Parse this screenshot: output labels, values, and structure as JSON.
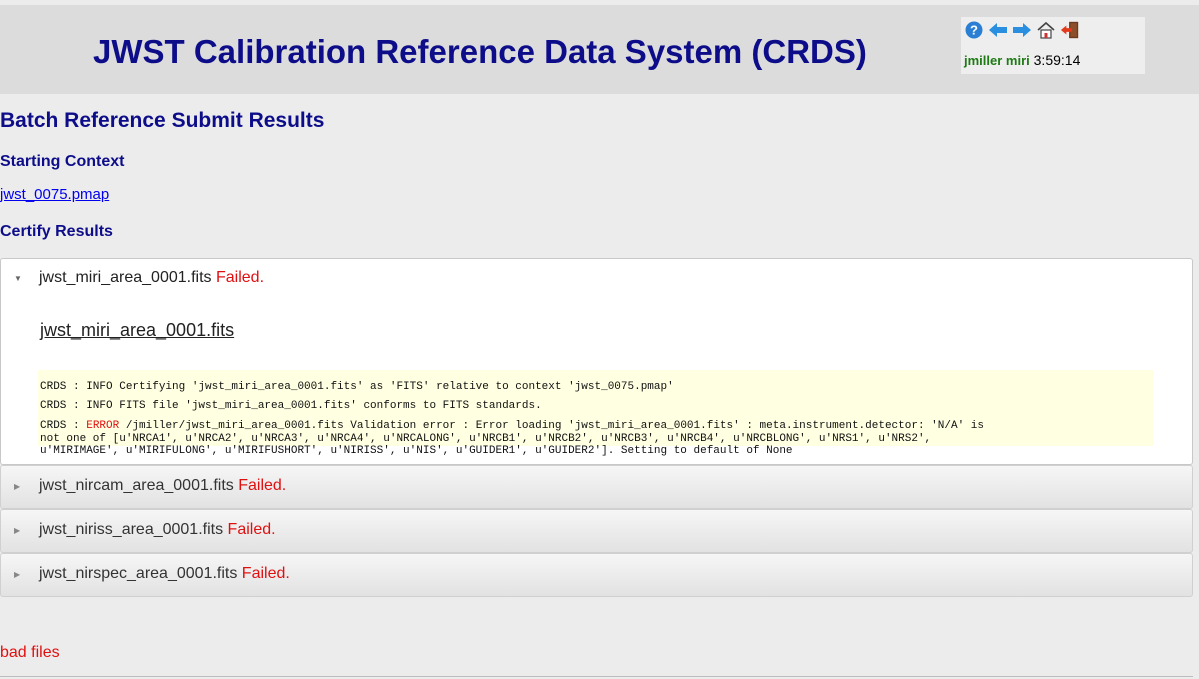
{
  "header": {
    "title": "JWST Calibration Reference Data System (CRDS)",
    "icons": [
      "help-icon",
      "back-arrow-icon",
      "forward-arrow-icon",
      "home-icon",
      "logout-icon"
    ],
    "user": "jmiller miri",
    "time": "3:59:14"
  },
  "page": {
    "heading": "Batch Reference Submit Results",
    "starting_context_label": "Starting Context",
    "context_link": "jwst_0075.pmap",
    "certify_label": "Certify Results"
  },
  "results": [
    {
      "file": "jwst_miri_area_0001.fits",
      "status": "Failed.",
      "expanded": true,
      "detail_link": "jwst_miri_area_0001.fits",
      "log": {
        "line1": "CRDS : INFO Certifying 'jwst_miri_area_0001.fits' as 'FITS' relative to context 'jwst_0075.pmap'",
        "line2": "CRDS : INFO FITS file 'jwst_miri_area_0001.fits' conforms to FITS standards.",
        "line3_prefix": "CRDS : ",
        "line3_level": "ERROR",
        "line3_rest": " /jmiller/jwst_miri_area_0001.fits Validation error : Error loading 'jwst_miri_area_0001.fits' : meta.instrument.detector: 'N/A' is",
        "line4": "not one of [u'NRCA1', u'NRCA2', u'NRCA3', u'NRCA4', u'NRCALONG', u'NRCB1', u'NRCB2', u'NRCB3', u'NRCB4', u'NRCBLONG', u'NRS1', u'NRS2',",
        "line5": "u'MIRIMAGE', u'MIRIFULONG', u'MIRIFUSHORT', u'NIRISS', u'NIS', u'GUIDER1', u'GUIDER2']. Setting to default of None"
      }
    },
    {
      "file": "jwst_nircam_area_0001.fits",
      "status": "Failed.",
      "expanded": false
    },
    {
      "file": "jwst_niriss_area_0001.fits",
      "status": "Failed.",
      "expanded": false
    },
    {
      "file": "jwst_nirspec_area_0001.fits",
      "status": "Failed.",
      "expanded": false
    }
  ],
  "footer": {
    "bad_files": "bad files"
  },
  "colors": {
    "title": "#0d0d8a",
    "failed": "#e01010",
    "user": "#1e7a14",
    "log_bg": "#ffffe2"
  }
}
